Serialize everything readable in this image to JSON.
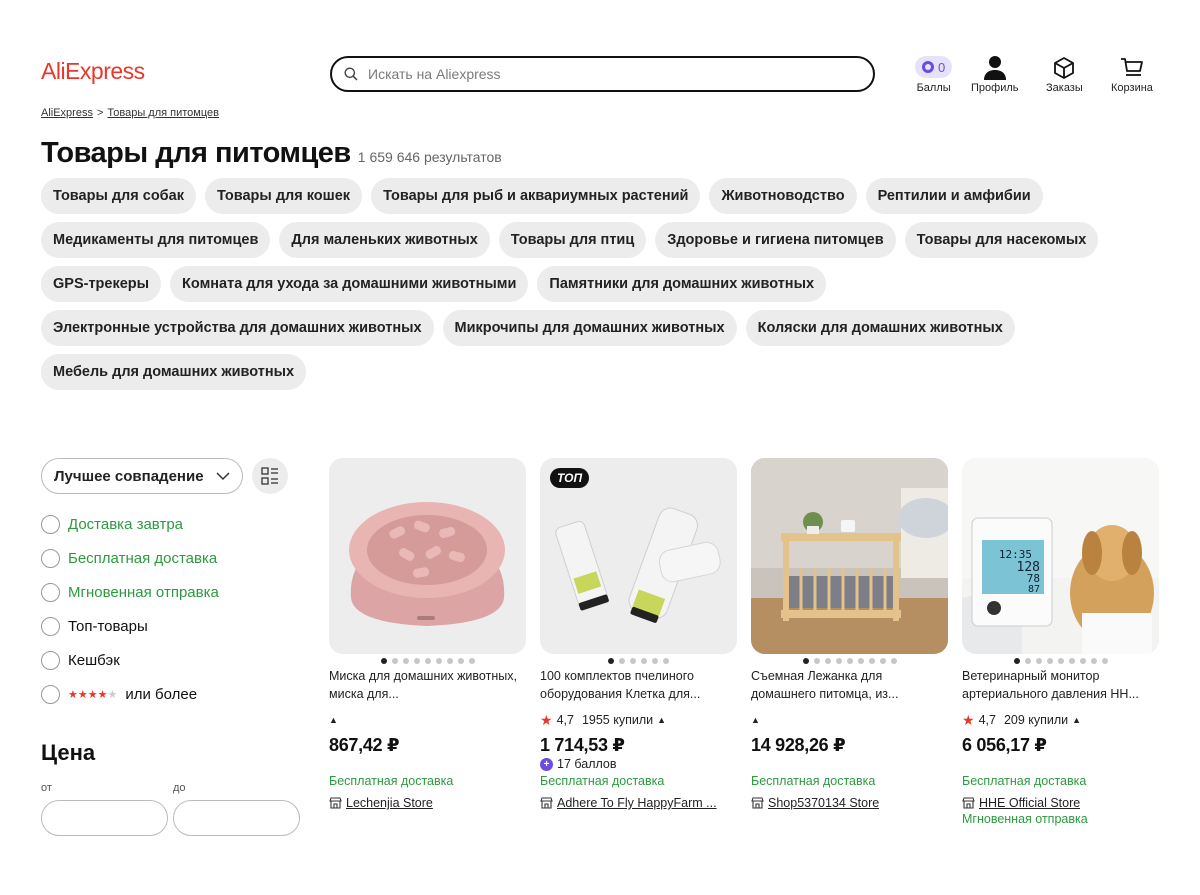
{
  "header": {
    "logo": "AliExpress",
    "search_placeholder": "Искать на Aliexpress",
    "points_value": "0",
    "nav": {
      "points": "Баллы",
      "profile": "Профиль",
      "orders": "Заказы",
      "cart": "Корзина"
    }
  },
  "breadcrumb": {
    "home": "AliExpress",
    "separator": ">",
    "current": "Товары для питомцев"
  },
  "page": {
    "title": "Товары для питомцев",
    "results": "1 659 646 результатов"
  },
  "categories": [
    "Товары для собак",
    "Товары для кошек",
    "Товары для рыб и аквариумных растений",
    "Животноводство",
    "Рептилии и амфибии",
    "Медикаменты для питомцев",
    "Для маленьких животных",
    "Товары для птиц",
    "Здоровье и гигиена питомцев",
    "Товары для насекомых",
    "GPS-трекеры",
    "Комната для ухода за домашними животными",
    "Памятники для домашних животных",
    "Электронные устройства для домашних животных",
    "Микрочипы для домашних животных",
    "Коляски для домашних животных",
    "Мебель для домашних животных"
  ],
  "sort": {
    "label": "Лучшее совпадение"
  },
  "filters": {
    "delivery_tomorrow": "Доставка завтра",
    "free_delivery": "Бесплатная доставка",
    "instant_dispatch": "Мгновенная отправка",
    "top_products": "Топ-товары",
    "cashback": "Кешбэк",
    "rating_suffix": "или более",
    "rating_stars": 4
  },
  "price": {
    "heading": "Цена",
    "from_label": "от",
    "to_label": "до"
  },
  "colors": {
    "brand": "#e8372b",
    "green": "#2c9a3f",
    "points": "#6c4cdc"
  },
  "products": [
    {
      "title": "Миска для домашних животных, миска для...",
      "rating": "",
      "sold": "",
      "price": "867,42 ₽",
      "bonus": "",
      "shipping": "Бесплатная доставка",
      "store": "Lechenjia Store",
      "extra": "",
      "badge": "",
      "image_slides": 9,
      "active_slide": 1
    },
    {
      "title": "100 комплектов пчелиного оборудования Клетка для...",
      "rating": "4,7",
      "sold": "1955 купили",
      "price": "1 714,53 ₽",
      "bonus": "17 баллов",
      "shipping": "Бесплатная доставка",
      "store": "Adhere To Fly HappyFarm ...",
      "extra": "",
      "badge": "ТОП",
      "image_slides": 6,
      "active_slide": 1
    },
    {
      "title": "Съемная Лежанка для домашнего питомца, из...",
      "rating": "",
      "sold": "",
      "price": "14 928,26 ₽",
      "bonus": "",
      "shipping": "Бесплатная доставка",
      "store": "Shop5370134 Store",
      "extra": "",
      "badge": "",
      "image_slides": 9,
      "active_slide": 1
    },
    {
      "title": "Ветеринарный монитор артериального давления HH...",
      "rating": "4,7",
      "sold": "209 купили",
      "price": "6 056,17 ₽",
      "bonus": "",
      "shipping": "Бесплатная доставка",
      "store": "HHE Official Store",
      "extra": "Мгновенная отправка",
      "badge": "",
      "monitor_screen": [
        "12:35",
        "128",
        "78",
        "87"
      ],
      "image_slides": 9,
      "active_slide": 1
    }
  ]
}
